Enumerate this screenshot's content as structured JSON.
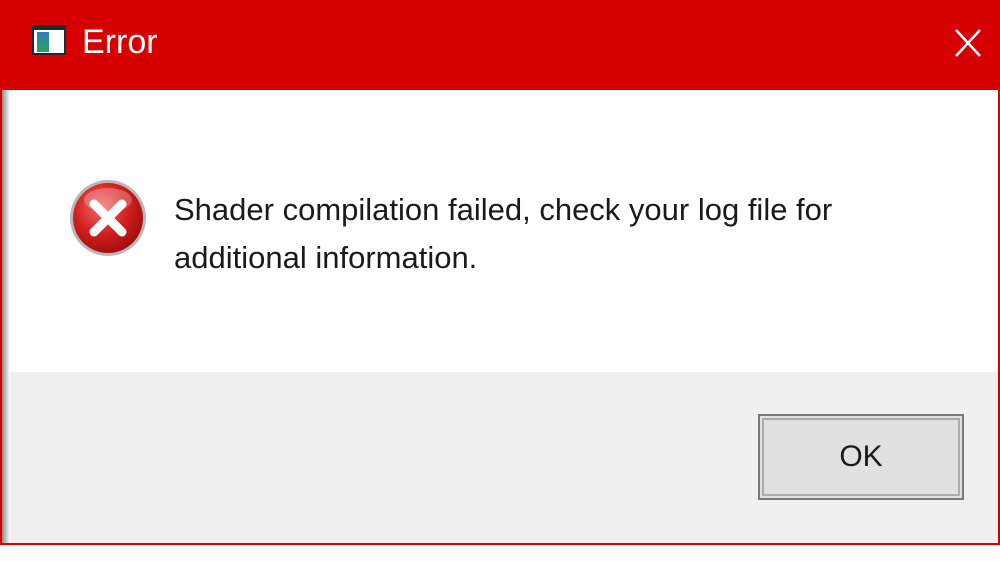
{
  "window": {
    "title": "Error",
    "accent_color": "#d70000",
    "title_text_color": "#ffffff",
    "app_icon": "window-app-icon",
    "close_icon": "close-icon"
  },
  "dialog": {
    "icon": "error-icon",
    "message": "Shader compilation failed, check your log file for additional information.",
    "ok_label": "OK"
  }
}
